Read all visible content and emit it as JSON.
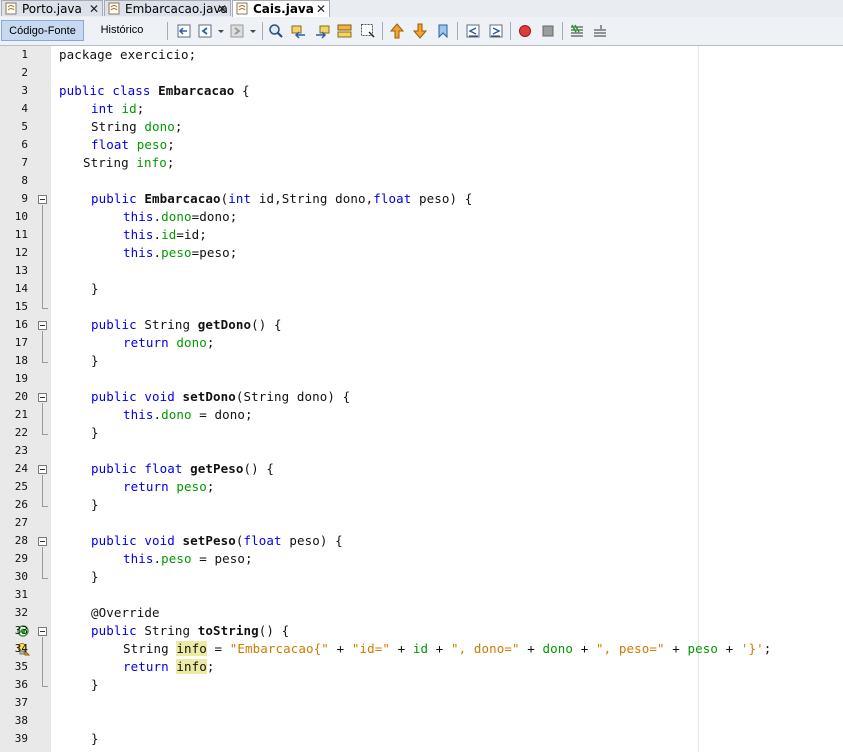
{
  "tabs": [
    {
      "label": "Porto.java",
      "active": false
    },
    {
      "label": "Embarcacao.java",
      "active": false
    },
    {
      "label": "Cais.java",
      "active": true
    }
  ],
  "toolbar": {
    "source_label": "Código-Fonte",
    "history_label": "Histórico"
  },
  "editor": {
    "lines": [
      {
        "n": "1"
      },
      {
        "n": "2"
      },
      {
        "n": "3"
      },
      {
        "n": "4"
      },
      {
        "n": "5"
      },
      {
        "n": "6"
      },
      {
        "n": "7"
      },
      {
        "n": "8"
      },
      {
        "n": "9"
      },
      {
        "n": "10"
      },
      {
        "n": "11"
      },
      {
        "n": "12"
      },
      {
        "n": "13"
      },
      {
        "n": "14"
      },
      {
        "n": "15"
      },
      {
        "n": "16"
      },
      {
        "n": "17"
      },
      {
        "n": "18"
      },
      {
        "n": "19"
      },
      {
        "n": "20"
      },
      {
        "n": "21"
      },
      {
        "n": "22"
      },
      {
        "n": "23"
      },
      {
        "n": "24"
      },
      {
        "n": "25"
      },
      {
        "n": "26"
      },
      {
        "n": "27"
      },
      {
        "n": "28"
      },
      {
        "n": "29"
      },
      {
        "n": "30"
      },
      {
        "n": "31"
      },
      {
        "n": "32"
      },
      {
        "n": "33"
      },
      {
        "n": "34"
      },
      {
        "n": "35"
      },
      {
        "n": "36"
      },
      {
        "n": "37"
      },
      {
        "n": "38"
      },
      {
        "n": "39"
      }
    ],
    "tokens": {
      "l1": [
        "package exercicio;"
      ],
      "l3": [
        "public class ",
        "Embarcacao",
        " {"
      ],
      "l4": [
        "int ",
        "id",
        ";"
      ],
      "l5": [
        "String ",
        "dono",
        ";"
      ],
      "l6": [
        "float ",
        "peso",
        ";"
      ],
      "l7": [
        "String ",
        "info",
        ";"
      ],
      "l9": [
        "public ",
        "Embarcacao",
        "(",
        "int",
        " id,String dono,",
        "float",
        " peso) {"
      ],
      "l10": [
        "this",
        ".",
        "dono",
        "=dono;"
      ],
      "l11": [
        "this",
        ".",
        "id",
        "=id;"
      ],
      "l12": [
        "this",
        ".",
        "peso",
        "=peso;"
      ],
      "l14": [
        "}"
      ],
      "l16": [
        "public ",
        "String ",
        "getDono",
        "() {"
      ],
      "l17": [
        "return ",
        "dono",
        ";"
      ],
      "l18": [
        "}"
      ],
      "l20": [
        "public void ",
        "setDono",
        "(String dono) {"
      ],
      "l21": [
        "this",
        ".",
        "dono",
        " = dono;"
      ],
      "l22": [
        "}"
      ],
      "l24": [
        "public float ",
        "getPeso",
        "() {"
      ],
      "l25": [
        "return ",
        "peso",
        ";"
      ],
      "l26": [
        "}"
      ],
      "l28": [
        "public void ",
        "setPeso",
        "(",
        "float",
        " peso) {"
      ],
      "l29": [
        "this",
        ".",
        "peso",
        " = peso;"
      ],
      "l30": [
        "}"
      ],
      "l32": [
        "@Override"
      ],
      "l33": [
        "public ",
        "String ",
        "toString",
        "() {"
      ],
      "l34": [
        "String ",
        "info",
        " = ",
        "\"Embarcacao{\"",
        " + ",
        "\"id=\"",
        " + ",
        "id",
        " + ",
        "\", dono=\"",
        " + ",
        "dono",
        " + ",
        "\", peso=\"",
        " + ",
        "peso",
        " + ",
        "'}'",
        ";"
      ],
      "l35": [
        "return ",
        "info",
        ";"
      ],
      "l36": [
        "}"
      ],
      "l39": [
        "}"
      ]
    }
  },
  "colors": {
    "keyword": "#0000e6",
    "field": "#009900",
    "string": "#ce7b00",
    "highlight": "#eceba4",
    "gutter": "#e9e9e9"
  },
  "icons": [
    "java-file-icon",
    "close-icon",
    "back-icon",
    "forward-icon",
    "search-icon",
    "bookmark-icon",
    "run-icon",
    "stop-icon",
    "override-icon",
    "warning-bulb-icon"
  ]
}
